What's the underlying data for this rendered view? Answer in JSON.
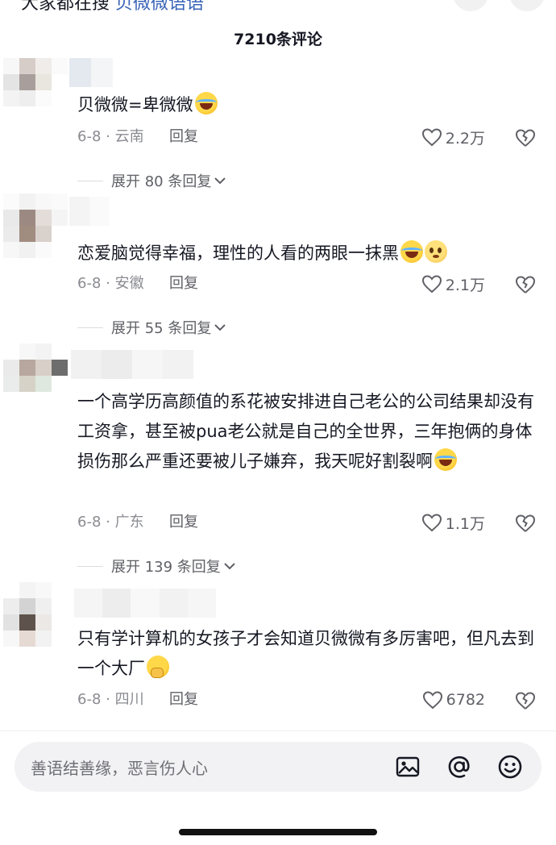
{
  "top": {
    "cut_text": "大家都在搜",
    "cut_text_blue": "贝微微语语"
  },
  "header": {
    "title": "7210条评论"
  },
  "comments": [
    {
      "text": "贝微微=卑微微",
      "emojis": [
        "laugh-cry"
      ],
      "date": "6-8 · 云南",
      "reply_label": "回复",
      "likes": "2.2万",
      "expand_label": "展开 80 条回复"
    },
    {
      "text": "恋爱脑觉得幸福，理性的人看的两眼一抹黑",
      "emojis": [
        "laugh-cry",
        "pleading"
      ],
      "date": "6-8 · 安徽",
      "reply_label": "回复",
      "likes": "2.1万",
      "expand_label": "展开 55 条回复"
    },
    {
      "text": "一个高学历高颜值的系花被安排进自己老公的公司结果却没有工资拿，甚至被pua老公就是自己的全世界，三年抱俩的身体损伤那么严重还要被儿子嫌弃，我天呢好割裂啊",
      "emojis": [
        "laugh-cry"
      ],
      "date": "6-8 · 广东",
      "reply_label": "回复",
      "likes": "1.1万",
      "expand_label": "展开 139 条回复"
    },
    {
      "text": "只有学计算机的女孩子才会知道贝微微有多厉害吧，但凡去到一个大厂",
      "emojis": [
        "hand-over-mouth"
      ],
      "date": "6-8 · 四川",
      "reply_label": "回复",
      "likes": "6782"
    }
  ],
  "input_bar": {
    "placeholder": "善语结善缘，恶言伤人心",
    "icons": [
      "image-icon",
      "mention-icon",
      "emoji-icon"
    ]
  },
  "colors": {
    "text": "#161823",
    "meta": "#8a8b91",
    "secondary": "#5f6066",
    "input_bg": "#f2f2f4"
  }
}
